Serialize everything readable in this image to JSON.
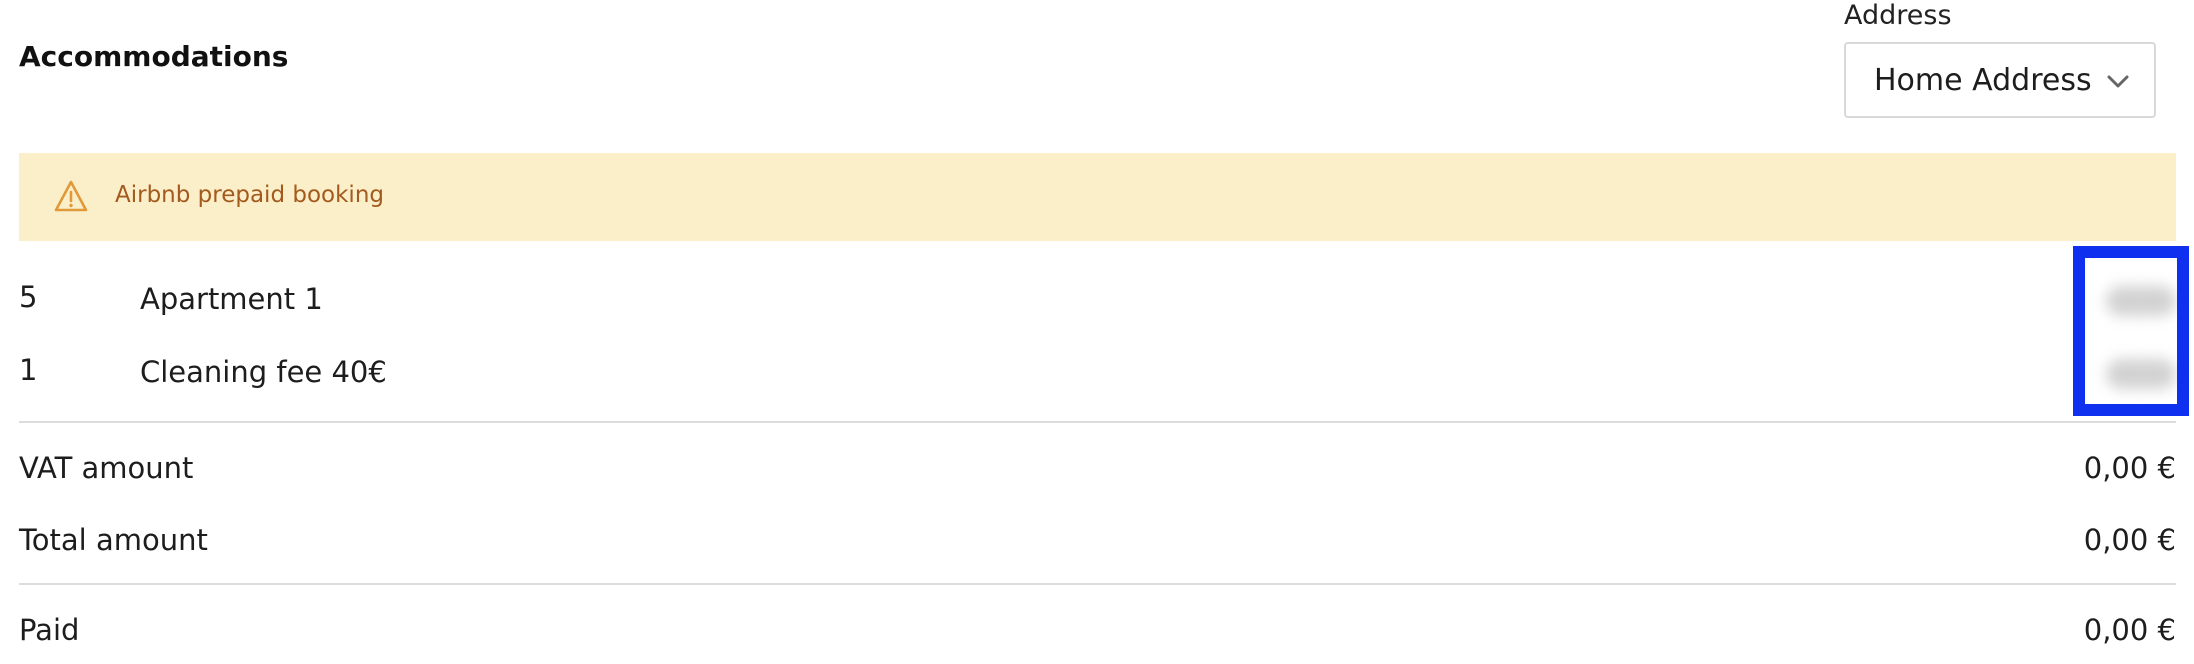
{
  "section": {
    "title": "Accommodations"
  },
  "address": {
    "label": "Address",
    "selected": "Home Address"
  },
  "alert": {
    "text": "Airbnb prepaid booking",
    "icon": "warning-triangle-icon",
    "background": "#fbefc9",
    "color": "#a35a1e",
    "icon_color": "#e09a3a"
  },
  "line_items": [
    {
      "qty": "5",
      "description": "Apartment 1"
    },
    {
      "qty": "1",
      "description": "Cleaning fee 40€"
    }
  ],
  "summary": {
    "vat_label": "VAT amount",
    "vat_amount": "0,00 €",
    "total_label": "Total amount",
    "total_amount": "0,00 €",
    "paid_label": "Paid",
    "paid_amount": "0,00 €"
  },
  "highlight_color": "#1030f0"
}
